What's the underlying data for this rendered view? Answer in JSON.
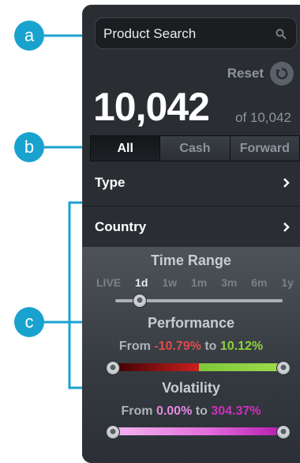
{
  "search": {
    "label": "Product Search",
    "icon": "search-icon"
  },
  "reset": {
    "label": "Reset",
    "icon": "refresh-icon"
  },
  "count": {
    "value": "10,042",
    "of_text": "of 10,042"
  },
  "segments": [
    {
      "label": "All",
      "active": true
    },
    {
      "label": "Cash",
      "active": false
    },
    {
      "label": "Forward",
      "active": false
    }
  ],
  "filters": [
    {
      "label": "Type"
    },
    {
      "label": "Country"
    }
  ],
  "time_range": {
    "title": "Time Range",
    "options": [
      "LIVE",
      "1d",
      "1w",
      "1m",
      "3m",
      "6m",
      "1y"
    ],
    "selected": "1d"
  },
  "performance": {
    "title": "Performance",
    "from_word": "From",
    "to_word": "to",
    "min": "-10.79%",
    "max": "10.12%",
    "colors": {
      "neg": "#e24a4a",
      "pos": "#8ed23c"
    }
  },
  "volatility": {
    "title": "Volatility",
    "from_word": "From",
    "to_word": "to",
    "min": "0.00%",
    "max": "304.37%"
  },
  "callouts": [
    "a",
    "b",
    "c"
  ],
  "accent": "#1aa2cf"
}
